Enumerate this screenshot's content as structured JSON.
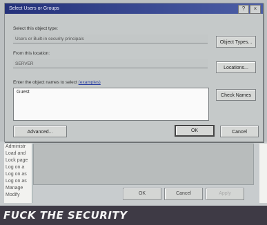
{
  "dialog": {
    "title": "Select Users or Groups",
    "object_type_label": "Select this object type:",
    "object_type_value": "Users or Built-in security principals",
    "object_types_button": "Object Types...",
    "location_label": "From this location:",
    "location_value": "SERVER",
    "locations_button": "Locations...",
    "names_label": "Enter the object names to select",
    "names_link": "(examples)",
    "names_value": "Guest",
    "check_names_button": "Check Names",
    "advanced_button": "Advanced...",
    "ok_button": "OK",
    "cancel_button": "Cancel",
    "help_button": "?",
    "close_button": "×"
  },
  "background_window": {
    "list_items": [
      "Administr",
      "Load and",
      "Lock page",
      "Log on a",
      "Log on as",
      "Log on as",
      "Manage",
      "Modify"
    ],
    "ok_button": "OK",
    "cancel_button": "Cancel",
    "apply_button": "Apply"
  },
  "caption": {
    "text": "FUCK THE SECURITY"
  }
}
